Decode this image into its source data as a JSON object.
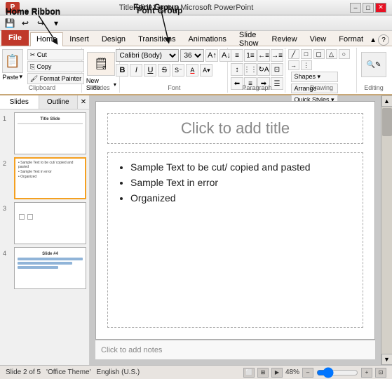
{
  "window": {
    "title": "Title Slide2.pptx - Microsoft PowerPoint",
    "controls": [
      "–",
      "□",
      "✕"
    ]
  },
  "annotations": {
    "home_ribbon_label": "Home Ribbon",
    "font_group_label": "Font Group"
  },
  "quick_access": {
    "buttons": [
      "💾",
      "↩",
      "↪",
      "▾"
    ]
  },
  "ribbon_tabs": [
    "File",
    "Home",
    "Insert",
    "Design",
    "Transitions",
    "Animations",
    "Slide Show",
    "Review",
    "View",
    "Format"
  ],
  "active_tab": "Home",
  "groups": {
    "clipboard": {
      "label": "Clipboard",
      "paste": "Paste",
      "buttons": [
        "Cut",
        "Copy",
        "Format Painter"
      ]
    },
    "slides": {
      "label": "Slides",
      "new_slide": "New Slide ▾"
    },
    "font": {
      "label": "Font",
      "font_name": "Calibri (Body)",
      "font_size": "36",
      "buttons_row1": [
        "A↑",
        "A↓"
      ],
      "buttons_row2": [
        "B",
        "I",
        "U",
        "S",
        "ab",
        "A",
        "A▾"
      ]
    },
    "paragraph": {
      "label": "Paragraph",
      "buttons": [
        "≡",
        "≡",
        "≡",
        "≡",
        "↕",
        "¶",
        "→",
        "←"
      ]
    },
    "drawing": {
      "label": "Drawing",
      "shapes": "Shapes",
      "arrange": "Arrange",
      "quick_styles": "Quick Styles ▾"
    },
    "editing": {
      "label": "Editing",
      "label_text": "Editing"
    }
  },
  "panel": {
    "tabs": [
      "Slides",
      "Outline"
    ],
    "slides": [
      {
        "num": "1",
        "type": "title",
        "preview_text": "Title Slide"
      },
      {
        "num": "2",
        "type": "content",
        "active": true,
        "lines": [
          "Sample Text to be cut/ copied and pasted",
          "Sample Text in error",
          "Organized"
        ]
      },
      {
        "num": "3",
        "type": "blank",
        "lines": []
      },
      {
        "num": "4",
        "type": "content",
        "preview_text": "Slide #4"
      }
    ]
  },
  "slide": {
    "title_placeholder": "Click to add title",
    "content": [
      "Sample Text to be cut/ copied and pasted",
      "Sample Text in error",
      "Organized"
    ],
    "notes_placeholder": "Click to add notes"
  },
  "status_bar": {
    "slide_info": "Slide 2 of 5",
    "theme": "'Office Theme'",
    "language": "English (U.S.)",
    "zoom": "48%"
  }
}
